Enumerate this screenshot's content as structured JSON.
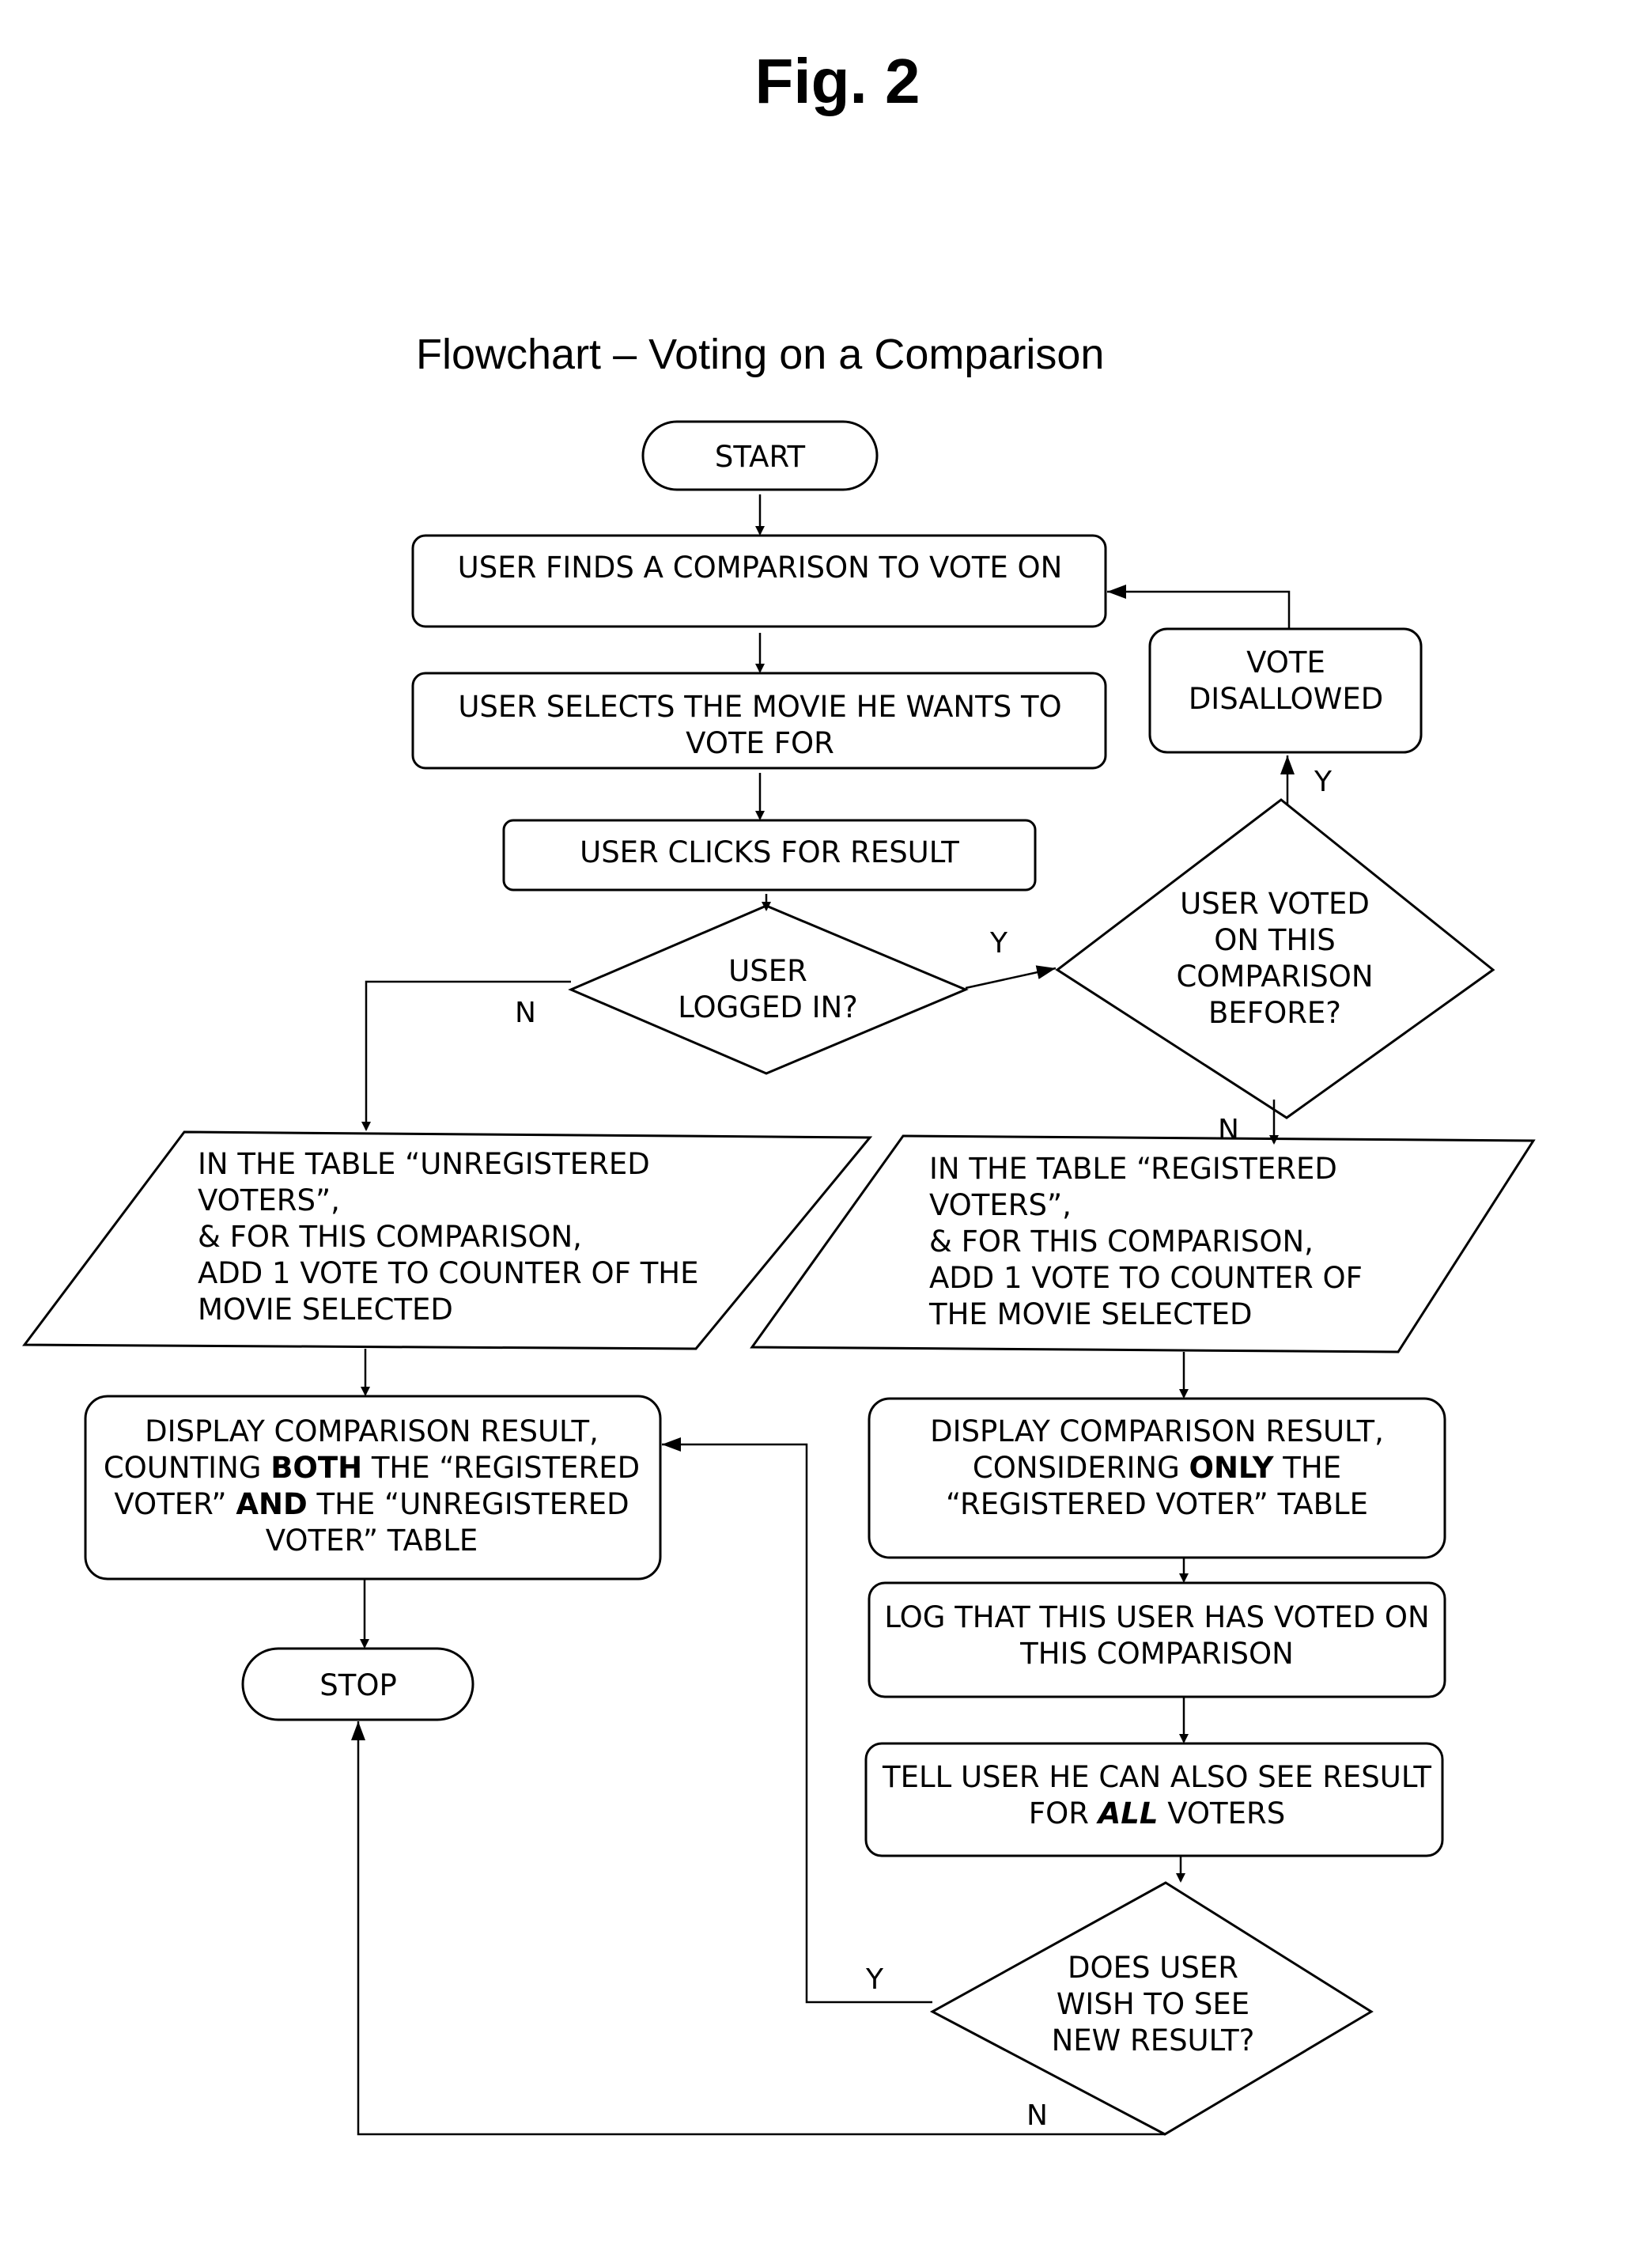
{
  "figure_label": "Fig. 2",
  "title": "Flowchart – Voting on a Comparison",
  "nodes": {
    "start": {
      "type": "terminator",
      "lines": [
        "START"
      ]
    },
    "find_comparison": {
      "type": "process",
      "lines": [
        "USER FINDS A COMPARISON TO VOTE ON"
      ]
    },
    "select_movie": {
      "type": "process",
      "lines": [
        "USER SELECTS THE MOVIE HE WANTS TO",
        "VOTE FOR"
      ]
    },
    "click_result": {
      "type": "process",
      "lines": [
        "USER CLICKS FOR RESULT"
      ]
    },
    "logged_in": {
      "type": "decision",
      "lines": [
        "USER",
        "LOGGED IN?"
      ]
    },
    "voted_before": {
      "type": "decision",
      "lines": [
        "USER VOTED",
        "ON THIS",
        "COMPARISON",
        "BEFORE?"
      ]
    },
    "vote_disallowed": {
      "type": "process",
      "lines": [
        "VOTE",
        "DISALLOWED"
      ]
    },
    "add_unregistered": {
      "type": "data",
      "lines": [
        "IN THE TABLE “UNREGISTERED",
        "VOTERS”,",
        "& FOR THIS COMPARISON,",
        "ADD 1 VOTE TO COUNTER OF THE",
        "MOVIE SELECTED"
      ]
    },
    "add_registered": {
      "type": "data",
      "lines": [
        "IN THE TABLE “REGISTERED",
        "VOTERS”,",
        "& FOR THIS COMPARISON,",
        "ADD 1 VOTE TO COUNTER OF",
        "THE MOVIE SELECTED"
      ]
    },
    "display_both": {
      "type": "process",
      "lines": [
        [
          {
            "t": "DISPLAY COMPARISON RESULT,"
          }
        ],
        [
          {
            "t": "COUNTING "
          },
          {
            "t": "BOTH",
            "b": true
          },
          {
            "t": " THE “REGISTERED"
          }
        ],
        [
          {
            "t": "VOTER” "
          },
          {
            "t": "AND",
            "b": true
          },
          {
            "t": " THE “UNREGISTERED"
          }
        ],
        [
          {
            "t": "VOTER” TABLE"
          }
        ]
      ]
    },
    "stop": {
      "type": "terminator",
      "lines": [
        "STOP"
      ]
    },
    "display_registered": {
      "type": "process",
      "lines": [
        [
          {
            "t": "DISPLAY COMPARISON RESULT,"
          }
        ],
        [
          {
            "t": "CONSIDERING "
          },
          {
            "t": "ONLY",
            "b": true
          },
          {
            "t": " THE"
          }
        ],
        [
          {
            "t": "“REGISTERED VOTER” TABLE"
          }
        ]
      ]
    },
    "log_vote": {
      "type": "process",
      "lines": [
        "LOG THAT THIS USER HAS VOTED ON",
        "THIS COMPARISON"
      ]
    },
    "tell_user": {
      "type": "process",
      "lines": [
        [
          {
            "t": "TELL USER HE CAN ALSO SEE RESULT"
          }
        ],
        [
          {
            "t": "FOR "
          },
          {
            "t": "ALL",
            "b": true,
            "i": true
          },
          {
            "t": " VOTERS"
          }
        ]
      ]
    },
    "wish_new_result": {
      "type": "decision",
      "lines": [
        "DOES USER",
        "WISH TO SEE",
        "NEW RESULT?"
      ]
    }
  },
  "edge_labels": {
    "logged_in_no": "N",
    "logged_in_yes": "Y",
    "voted_before_yes": "Y",
    "voted_before_no": "N",
    "wish_yes": "Y",
    "wish_no": "N"
  }
}
